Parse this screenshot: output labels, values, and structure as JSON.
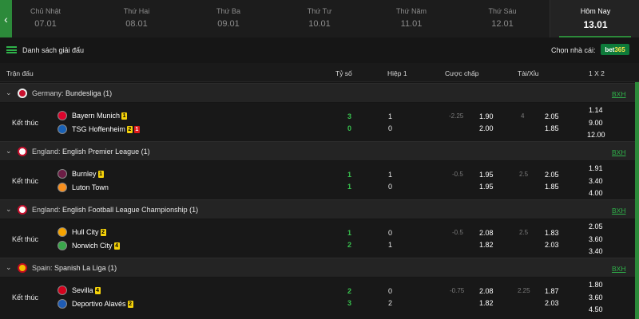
{
  "colors": {
    "accent": "#2c8a3a",
    "score": "#38c24e",
    "link": "#2fb34a",
    "bg": "#161616"
  },
  "nav": {
    "back_icon": "‹"
  },
  "days": [
    {
      "name": "Chủ Nhật",
      "date": "07.01"
    },
    {
      "name": "Thứ Hai",
      "date": "08.01"
    },
    {
      "name": "Thứ Ba",
      "date": "09.01"
    },
    {
      "name": "Thứ Tư",
      "date": "10.01"
    },
    {
      "name": "Thứ Năm",
      "date": "11.01"
    },
    {
      "name": "Thứ Sáu",
      "date": "12.01"
    },
    {
      "name": "Hôm Nay",
      "date": "13.01"
    }
  ],
  "toolbar": {
    "league_list": "Danh sách giải đấu",
    "bookmaker_label": "Chọn nhà cái:",
    "bookmaker_a": "bet",
    "bookmaker_b": "365"
  },
  "header": {
    "match": "Trận đấu",
    "score": "Tỷ số",
    "half": "Hiệp 1",
    "handicap": "Cược chấp",
    "overunder": "Tài/Xỉu",
    "onextwo": "1 X 2"
  },
  "leagues": [
    {
      "country": "Germany:",
      "name": "Bundesliga",
      "count": "(1)",
      "bxh": "BXH",
      "match": {
        "status": "Kết thúc",
        "home": {
          "name": "Bayern Munich",
          "cards": [
            {
              "type": "yellow",
              "n": "1"
            }
          ]
        },
        "away": {
          "name": "TSG Hoffenheim",
          "cards": [
            {
              "type": "yellow",
              "n": "2"
            },
            {
              "type": "red",
              "n": "1"
            }
          ]
        },
        "score": [
          "3",
          "0"
        ],
        "half": [
          "1",
          "0"
        ],
        "handicap_line": "-2.25",
        "handicap": [
          "1.90",
          "2.00"
        ],
        "ou_line": "4",
        "ou": [
          "2.05",
          "1.85"
        ],
        "x12": [
          "1.14",
          "9.00",
          "12.00"
        ]
      }
    },
    {
      "country": "England:",
      "name": "English Premier League",
      "count": "(1)",
      "bxh": "BXH",
      "match": {
        "status": "Kết thúc",
        "home": {
          "name": "Burnley",
          "cards": [
            {
              "type": "yellow",
              "n": "1"
            }
          ]
        },
        "away": {
          "name": "Luton Town",
          "cards": []
        },
        "score": [
          "1",
          "1"
        ],
        "half": [
          "1",
          "0"
        ],
        "handicap_line": "-0.5",
        "handicap": [
          "1.95",
          "1.95"
        ],
        "ou_line": "2.5",
        "ou": [
          "2.05",
          "1.85"
        ],
        "x12": [
          "1.91",
          "3.40",
          "4.00"
        ]
      }
    },
    {
      "country": "England:",
      "name": "English Football League Championship",
      "count": "(1)",
      "bxh": "BXH",
      "match": {
        "status": "Kết thúc",
        "home": {
          "name": "Hull City",
          "cards": [
            {
              "type": "yellow",
              "n": "2"
            }
          ]
        },
        "away": {
          "name": "Norwich City",
          "cards": [
            {
              "type": "yellow",
              "n": "4"
            }
          ]
        },
        "score": [
          "1",
          "2"
        ],
        "half": [
          "0",
          "1"
        ],
        "handicap_line": "-0.5",
        "handicap": [
          "2.08",
          "1.82"
        ],
        "ou_line": "2.5",
        "ou": [
          "1.83",
          "2.03"
        ],
        "x12": [
          "2.05",
          "3.60",
          "3.40"
        ]
      }
    },
    {
      "country": "Spain:",
      "name": "Spanish La Liga",
      "count": "(1)",
      "bxh": "BXH",
      "match": {
        "status": "Kết thúc",
        "home": {
          "name": "Sevilla",
          "cards": [
            {
              "type": "yellow",
              "n": "4"
            }
          ]
        },
        "away": {
          "name": "Deportivo Alavés",
          "cards": [
            {
              "type": "yellow",
              "n": "2"
            }
          ]
        },
        "score": [
          "2",
          "3"
        ],
        "half": [
          "0",
          "2"
        ],
        "handicap_line": "-0.75",
        "handicap": [
          "2.08",
          "1.82"
        ],
        "ou_line": "2.25",
        "ou": [
          "1.87",
          "2.03"
        ],
        "x12": [
          "1.80",
          "3.60",
          "4.50"
        ]
      }
    }
  ]
}
